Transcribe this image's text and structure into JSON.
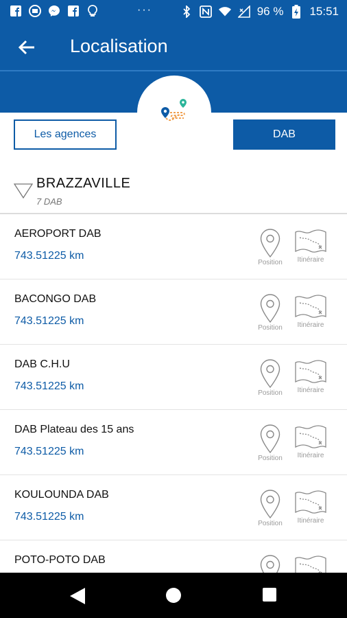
{
  "status_bar": {
    "icons_left": [
      "facebook-icon",
      "world-news-icon",
      "messenger-icon",
      "facebook-icon",
      "lightbulb-icon"
    ],
    "overflow": "···",
    "icons_right": [
      "bluetooth-icon",
      "nfc-icon",
      "wifi-icon",
      "signal-icon"
    ],
    "battery": "96 %",
    "time": "15:51"
  },
  "app_bar": {
    "title": "Localisation"
  },
  "buttons": {
    "agences": "Les agences",
    "dab": "DAB"
  },
  "city": {
    "name": "BRAZZAVILLE",
    "count": "7 DAB"
  },
  "action_labels": {
    "position": "Position",
    "itinerary": "Itinéraire"
  },
  "dab_list": [
    {
      "name": "AEROPORT DAB",
      "distance": "743.51225 km"
    },
    {
      "name": "BACONGO DAB",
      "distance": "743.51225 km"
    },
    {
      "name": "DAB C.H.U",
      "distance": "743.51225 km"
    },
    {
      "name": "DAB Plateau des 15 ans",
      "distance": "743.51225 km"
    },
    {
      "name": "KOULOUNDA DAB",
      "distance": "743.51225 km"
    },
    {
      "name": "POTO-POTO DAB",
      "distance": ""
    }
  ],
  "colors": {
    "primary": "#0d5ba6",
    "accent_orange": "#f0a050",
    "accent_green": "#2bb59a"
  }
}
